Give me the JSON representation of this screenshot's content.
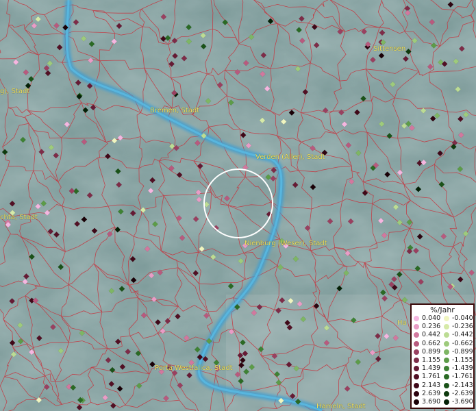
{
  "map": {
    "cities": [
      {
        "name": "g), Stadt",
        "pos": "west-edge"
      },
      {
        "name": "Bremen, Stadt",
        "pos": "north-west"
      },
      {
        "name": "Sittensen",
        "pos": "north-east"
      },
      {
        "name": "Verden (Aller), Stadt",
        "pos": "center-east"
      },
      {
        "name": "chta, Stadt",
        "pos": "west-edge"
      },
      {
        "name": "Nienburg (Weser), Stadt",
        "pos": "center"
      },
      {
        "name": "Porta Westfalica, Stadt",
        "pos": "south"
      },
      {
        "name": "Hameln, Stadt",
        "pos": "south-east"
      },
      {
        "name": "Ha",
        "pos": "east-edge"
      }
    ],
    "colors": {
      "background": "#7f9c9a",
      "river": "#4aa8d0",
      "borders": "#c8323c",
      "labels": "#f0e060",
      "selection_circle": "#ffffff"
    }
  },
  "legend": {
    "title": "%/Jahr",
    "positive": [
      {
        "value": "0.040",
        "color": "#f5b6e0"
      },
      {
        "value": "0.236",
        "color": "#e99cc6"
      },
      {
        "value": "0.442",
        "color": "#d2789e"
      },
      {
        "value": "0.662",
        "color": "#b85a7e"
      },
      {
        "value": "0.899",
        "color": "#9a4060"
      },
      {
        "value": "1.155",
        "color": "#7e2c48"
      },
      {
        "value": "1.439",
        "color": "#661a34"
      },
      {
        "value": "1.761",
        "color": "#521024"
      },
      {
        "value": "2.143",
        "color": "#400818"
      },
      {
        "value": "2.639",
        "color": "#2e0410"
      },
      {
        "value": "3.690",
        "color": "#1a0006"
      }
    ],
    "negative": [
      {
        "value": "-0.040",
        "color": "#f0f5c0"
      },
      {
        "value": "-0.236",
        "color": "#d6eaa8"
      },
      {
        "value": "-0.442",
        "color": "#bcdc94"
      },
      {
        "value": "-0.662",
        "color": "#9ecb7c"
      },
      {
        "value": "-0.899",
        "color": "#7eb664"
      },
      {
        "value": "-1.155",
        "color": "#5c9c48"
      },
      {
        "value": "-1.439",
        "color": "#3e8234"
      },
      {
        "value": "-1.761",
        "color": "#2a6a24"
      },
      {
        "value": "-2.143",
        "color": "#1a5218"
      },
      {
        "value": "-2.639",
        "color": "#0e3a0e"
      },
      {
        "value": "-3.690",
        "color": "#042006"
      }
    ]
  }
}
